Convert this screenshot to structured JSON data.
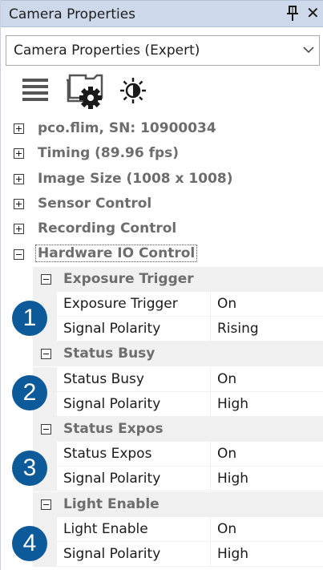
{
  "window": {
    "title": "Camera Properties",
    "pin_icon": "pin-icon",
    "close_glyph": "✕"
  },
  "dropdown": {
    "selected": "Camera Properties (Expert)"
  },
  "toolbar": {
    "icons": [
      "list-icon",
      "camera-settings-icon",
      "brightness-icon"
    ]
  },
  "tree": {
    "categories": [
      {
        "label": "pco.flim, SN: 10900034",
        "expanded": false
      },
      {
        "label": "Timing (89.96 fps)",
        "expanded": false
      },
      {
        "label": "Image Size (1008 x 1008)",
        "expanded": false
      },
      {
        "label": "Sensor Control",
        "expanded": false
      },
      {
        "label": "Recording Control",
        "expanded": false
      },
      {
        "label": "Hardware IO Control",
        "expanded": true
      }
    ],
    "groups": [
      {
        "title": "Exposure Trigger",
        "badge": "1",
        "props": [
          {
            "name": "Exposure Trigger",
            "value": "On"
          },
          {
            "name": "Signal Polarity",
            "value": "Rising"
          }
        ]
      },
      {
        "title": "Status Busy",
        "badge": "2",
        "props": [
          {
            "name": "Status Busy",
            "value": "On"
          },
          {
            "name": "Signal Polarity",
            "value": "High"
          }
        ]
      },
      {
        "title": "Status Expos",
        "badge": "3",
        "props": [
          {
            "name": "Status Expos",
            "value": "On"
          },
          {
            "name": "Signal Polarity",
            "value": "High"
          }
        ]
      },
      {
        "title": "Light Enable",
        "badge": "4",
        "props": [
          {
            "name": "Light Enable",
            "value": "On"
          },
          {
            "name": "Signal Polarity",
            "value": "High"
          }
        ]
      }
    ]
  },
  "colors": {
    "titlebar_bg": "#cdd8ea",
    "badge_bg": "#0d5a9a",
    "category_text": "#6d6d6d",
    "subhead_bg": "#f0f0f0"
  }
}
